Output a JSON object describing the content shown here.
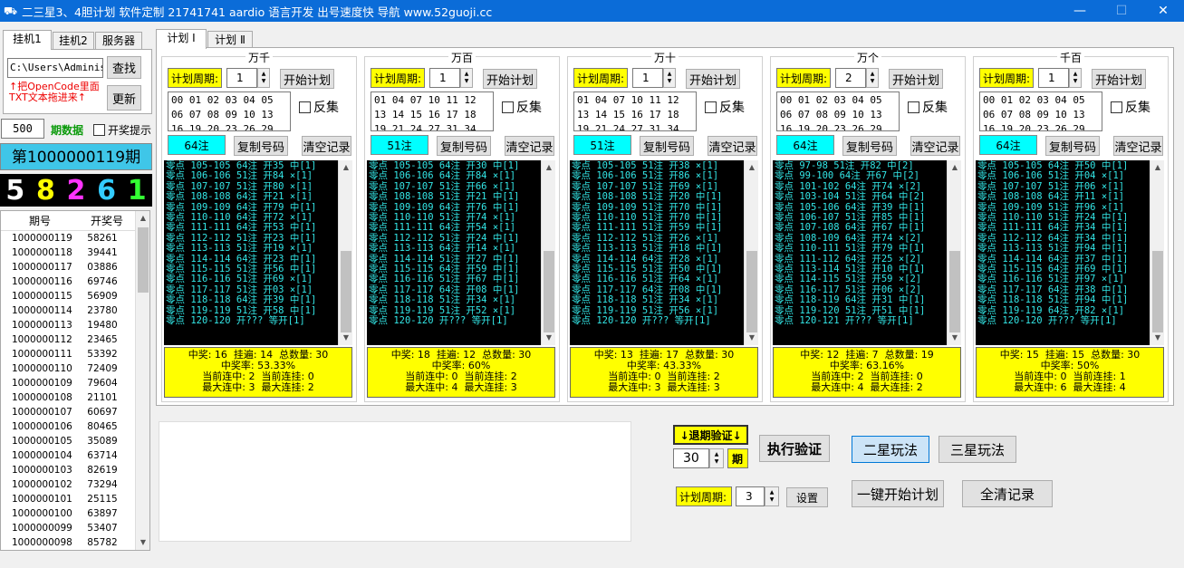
{
  "window": {
    "title": "二三星3、4胆计划 软件定制 21741741 aardio 语言开发 出号速度快 导航 www.52guoji.cc",
    "min": "—",
    "max": "☐",
    "close": "✕"
  },
  "left": {
    "tabs": [
      "挂机1",
      "挂机2",
      "服务器"
    ],
    "path": "C:\\Users\\Administ",
    "find_button": "查找",
    "refresh_button": "更新",
    "hint_line1": "↑把OpenCode里面",
    "hint_line2": "TXT文本拖进来↑",
    "count": "500",
    "period_data_label": "期数据",
    "open_prompt_label": "开奖提示",
    "current_period": "第1000000119期",
    "digits": [
      {
        "v": "5",
        "color": "#ffffff"
      },
      {
        "v": "8",
        "color": "#ffff00"
      },
      {
        "v": "2",
        "color": "#ff33ff"
      },
      {
        "v": "6",
        "color": "#33ccff"
      },
      {
        "v": "1",
        "color": "#33ff33"
      }
    ],
    "history_headers": [
      "期号",
      "开奖号"
    ],
    "history": [
      [
        "1000000119",
        "58261"
      ],
      [
        "1000000118",
        "39441"
      ],
      [
        "1000000117",
        "03886"
      ],
      [
        "1000000116",
        "69746"
      ],
      [
        "1000000115",
        "56909"
      ],
      [
        "1000000114",
        "23780"
      ],
      [
        "1000000113",
        "19480"
      ],
      [
        "1000000112",
        "23465"
      ],
      [
        "1000000111",
        "53392"
      ],
      [
        "1000000110",
        "72409"
      ],
      [
        "1000000109",
        "79604"
      ],
      [
        "1000000108",
        "21101"
      ],
      [
        "1000000107",
        "60697"
      ],
      [
        "1000000106",
        "80465"
      ],
      [
        "1000000105",
        "35089"
      ],
      [
        "1000000104",
        "63714"
      ],
      [
        "1000000103",
        "82619"
      ],
      [
        "1000000102",
        "73294"
      ],
      [
        "1000000101",
        "25115"
      ],
      [
        "1000000100",
        "63897"
      ],
      [
        "1000000099",
        "53407"
      ],
      [
        "1000000098",
        "85782"
      ]
    ]
  },
  "main_tabs": [
    "计划 Ⅰ",
    "计划 Ⅱ"
  ],
  "groups": [
    {
      "title": "万千",
      "period_label": "计划周期:",
      "period": "1",
      "start_button": "开始计划",
      "numbers": "00 01 02 03 04 05\n06 07 08 09 10 13\n16 19 20 23 26 29",
      "reverse_label": "反集",
      "count_label": "64注",
      "copy_button": "复制号码",
      "clear_button": "清空记录",
      "log": "零点 105-105 64注 开35 中[1]\n零点 106-106 51注 开84 ×[1]\n零点 107-107 51注 开80 ×[1]\n零点 108-108 64注 开21 ×[1]\n零点 109-109 64注 开79 中[1]\n零点 110-110 64注 开72 ×[1]\n零点 111-111 64注 开53 中[1]\n零点 112-112 51注 开23 中[1]\n零点 113-113 51注 开19 ×[1]\n零点 114-114 64注 开23 中[1]\n零点 115-115 51注 开56 中[1]\n零点 116-116 51注 开69 ×[1]\n零点 117-117 51注 开03 ×[1]\n零点 118-118 64注 开39 中[1]\n零点 119-119 51注 开58 中[1]\n零点 120-120 开??? 等开[1]",
      "stats": "中奖: 16  挂遍: 14  总数量: 30\n中奖率: 53.33%\n当前连中: 2  当前连挂: 0\n最大连中: 3  最大连挂: 2"
    },
    {
      "title": "万百",
      "period_label": "计划周期:",
      "period": "1",
      "start_button": "开始计划",
      "numbers": "01 04 07 10 11 12\n13 14 15 16 17 18\n19 21 24 27 31 34",
      "reverse_label": "反集",
      "count_label": "51注",
      "copy_button": "复制号码",
      "clear_button": "清空记录",
      "log": "零点 105-105 64注 开30 中[1]\n零点 106-106 64注 开84 ×[1]\n零点 107-107 51注 开66 ×[1]\n零点 108-108 51注 开21 中[1]\n零点 109-109 64注 开76 中[1]\n零点 110-110 51注 开74 ×[1]\n零点 111-111 64注 开54 ×[1]\n零点 112-112 51注 开24 中[1]\n零点 113-113 64注 开14 ×[1]\n零点 114-114 51注 开27 中[1]\n零点 115-115 64注 开59 中[1]\n零点 116-116 51注 开67 中[1]\n零点 117-117 64注 开08 中[1]\n零点 118-118 51注 开34 ×[1]\n零点 119-119 51注 开52 ×[1]\n零点 120-120 开??? 等开[1]",
      "stats": "中奖: 18  挂遍: 12  总数量: 30\n中奖率: 60%\n当前连中: 0  当前连挂: 2\n最大连中: 4  最大连挂: 3"
    },
    {
      "title": "万十",
      "period_label": "计划周期:",
      "period": "1",
      "start_button": "开始计划",
      "numbers": "01 04 07 10 11 12\n13 14 15 16 17 18\n19 21 24 27 31 34",
      "reverse_label": "反集",
      "count_label": "51注",
      "copy_button": "复制号码",
      "clear_button": "清空记录",
      "log": "零点 105-105 51注 开38 ×[1]\n零点 106-106 51注 开86 ×[1]\n零点 107-107 51注 开69 ×[1]\n零点 108-108 51注 开20 中[1]\n零点 109-109 51注 开70 中[1]\n零点 110-110 51注 开70 中[1]\n零点 111-111 51注 开59 中[1]\n零点 112-112 51注 开26 ×[1]\n零点 113-113 51注 开18 中[1]\n零点 114-114 64注 开28 ×[1]\n零点 115-115 51注 开50 中[1]\n零点 116-116 51注 开64 ×[1]\n零点 117-117 64注 开08 中[1]\n零点 118-118 51注 开34 ×[1]\n零点 119-119 51注 开56 ×[1]\n零点 120-120 开??? 等开[1]",
      "stats": "中奖: 13  挂遍: 17  总数量: 30\n中奖率: 43.33%\n当前连中: 0  当前连挂: 2\n最大连中: 3  最大连挂: 3"
    },
    {
      "title": "万个",
      "period_label": "计划周期:",
      "period": "2",
      "start_button": "开始计划",
      "numbers": "00 01 02 03 04 05\n06 07 08 09 10 13\n16 19 20 23 26 29",
      "reverse_label": "反集",
      "count_label": "64注",
      "copy_button": "复制号码",
      "clear_button": "清空记录",
      "log": "零点 97-98 51注 开82 中[2]\n零点 99-100 64注 开67 中[2]\n零点 101-102 64注 开74 ×[2]\n零点 103-104 51注 开64 中[2]\n零点 105-106 64注 开39 中[1]\n零点 106-107 51注 开85 中[1]\n零点 107-108 64注 开67 中[1]\n零点 108-109 64注 开74 ×[2]\n零点 110-111 51注 开79 中[1]\n零点 111-112 64注 开25 ×[2]\n零点 113-114 51注 开10 中[1]\n零点 114-115 51注 开59 ×[2]\n零点 116-117 51注 开06 ×[2]\n零点 118-119 64注 开31 中[1]\n零点 119-120 51注 开51 中[1]\n零点 120-121 开??? 等开[1]",
      "stats": "中奖: 12  挂遍: 7  总数量: 19\n中奖率: 63.16%\n当前连中: 2  当前连挂: 0\n最大连中: 4  最大连挂: 2"
    },
    {
      "title": "千百",
      "period_label": "计划周期:",
      "period": "1",
      "start_button": "开始计划",
      "numbers": "00 01 02 03 04 05\n06 07 08 09 10 13\n16 19 20 23 26 29",
      "reverse_label": "反集",
      "count_label": "64注",
      "copy_button": "复制号码",
      "clear_button": "清空记录",
      "log": "零点 105-105 64注 开50 中[1]\n零点 106-106 51注 开04 ×[1]\n零点 107-107 51注 开06 ×[1]\n零点 108-108 64注 开11 ×[1]\n零点 109-109 51注 开96 ×[1]\n零点 110-110 51注 开24 中[1]\n零点 111-111 64注 开34 中[1]\n零点 112-112 64注 开34 中[1]\n零点 113-113 51注 开94 中[1]\n零点 114-114 64注 开37 中[1]\n零点 115-115 64注 开69 中[1]\n零点 116-116 51注 开97 ×[1]\n零点 117-117 64注 开38 中[1]\n零点 118-118 51注 开94 中[1]\n零点 119-119 64注 开82 ×[1]\n零点 120-120 开??? 等开[1]",
      "stats": "中奖: 15  挂遍: 15  总数量: 30\n中奖率: 50%\n当前连中: 0  当前连挂: 1\n最大连中: 6  最大连挂: 4"
    }
  ],
  "bottom": {
    "backtest_label": "↓退期验证↓",
    "backtest_value": "30",
    "backtest_unit": "期",
    "execute_button": "执行验证",
    "two_star_button": "二星玩法",
    "three_star_button": "三星玩法",
    "plan_period_label": "计划周期:",
    "plan_period_value": "3",
    "set_button": "设置",
    "start_all_button": "一键开始计划",
    "clear_all_button": "全清记录"
  }
}
